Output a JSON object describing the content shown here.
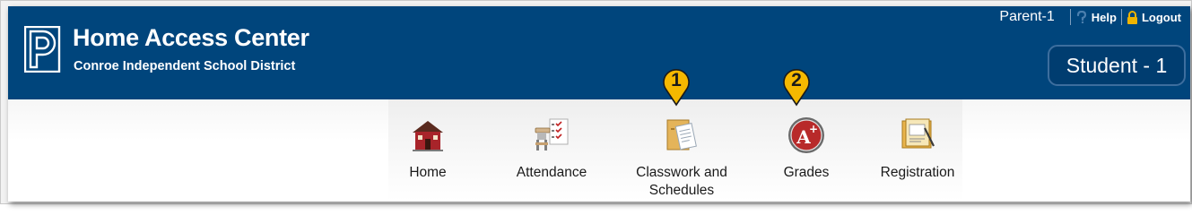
{
  "brand": {
    "title": "Home Access Center",
    "subtitle": "Conroe Independent School District",
    "logo_icon": "powerschool-p-logo-icon"
  },
  "topbar": {
    "user_name": "Parent-1",
    "help_label": "Help",
    "logout_label": "Logout",
    "help_icon": "help-question-icon",
    "logout_icon": "lock-icon"
  },
  "student_selector": {
    "label": "Student - 1"
  },
  "nav": {
    "items": [
      {
        "label": "Home",
        "icon": "schoolhouse-icon"
      },
      {
        "label": "Attendance",
        "icon": "desk-checklist-icon"
      },
      {
        "label": "Classwork and\nSchedules",
        "icon": "folder-document-icon"
      },
      {
        "label": "Grades",
        "icon": "a-plus-badge-icon"
      },
      {
        "label": "Registration",
        "icon": "clipboard-form-icon"
      }
    ]
  },
  "callouts": [
    {
      "number": "1",
      "target": "Classwork and Schedules"
    },
    {
      "number": "2",
      "target": "Grades"
    }
  ],
  "colors": {
    "header_bg": "#00457c",
    "callout_fill": "#f5b800",
    "white": "#ffffff"
  }
}
